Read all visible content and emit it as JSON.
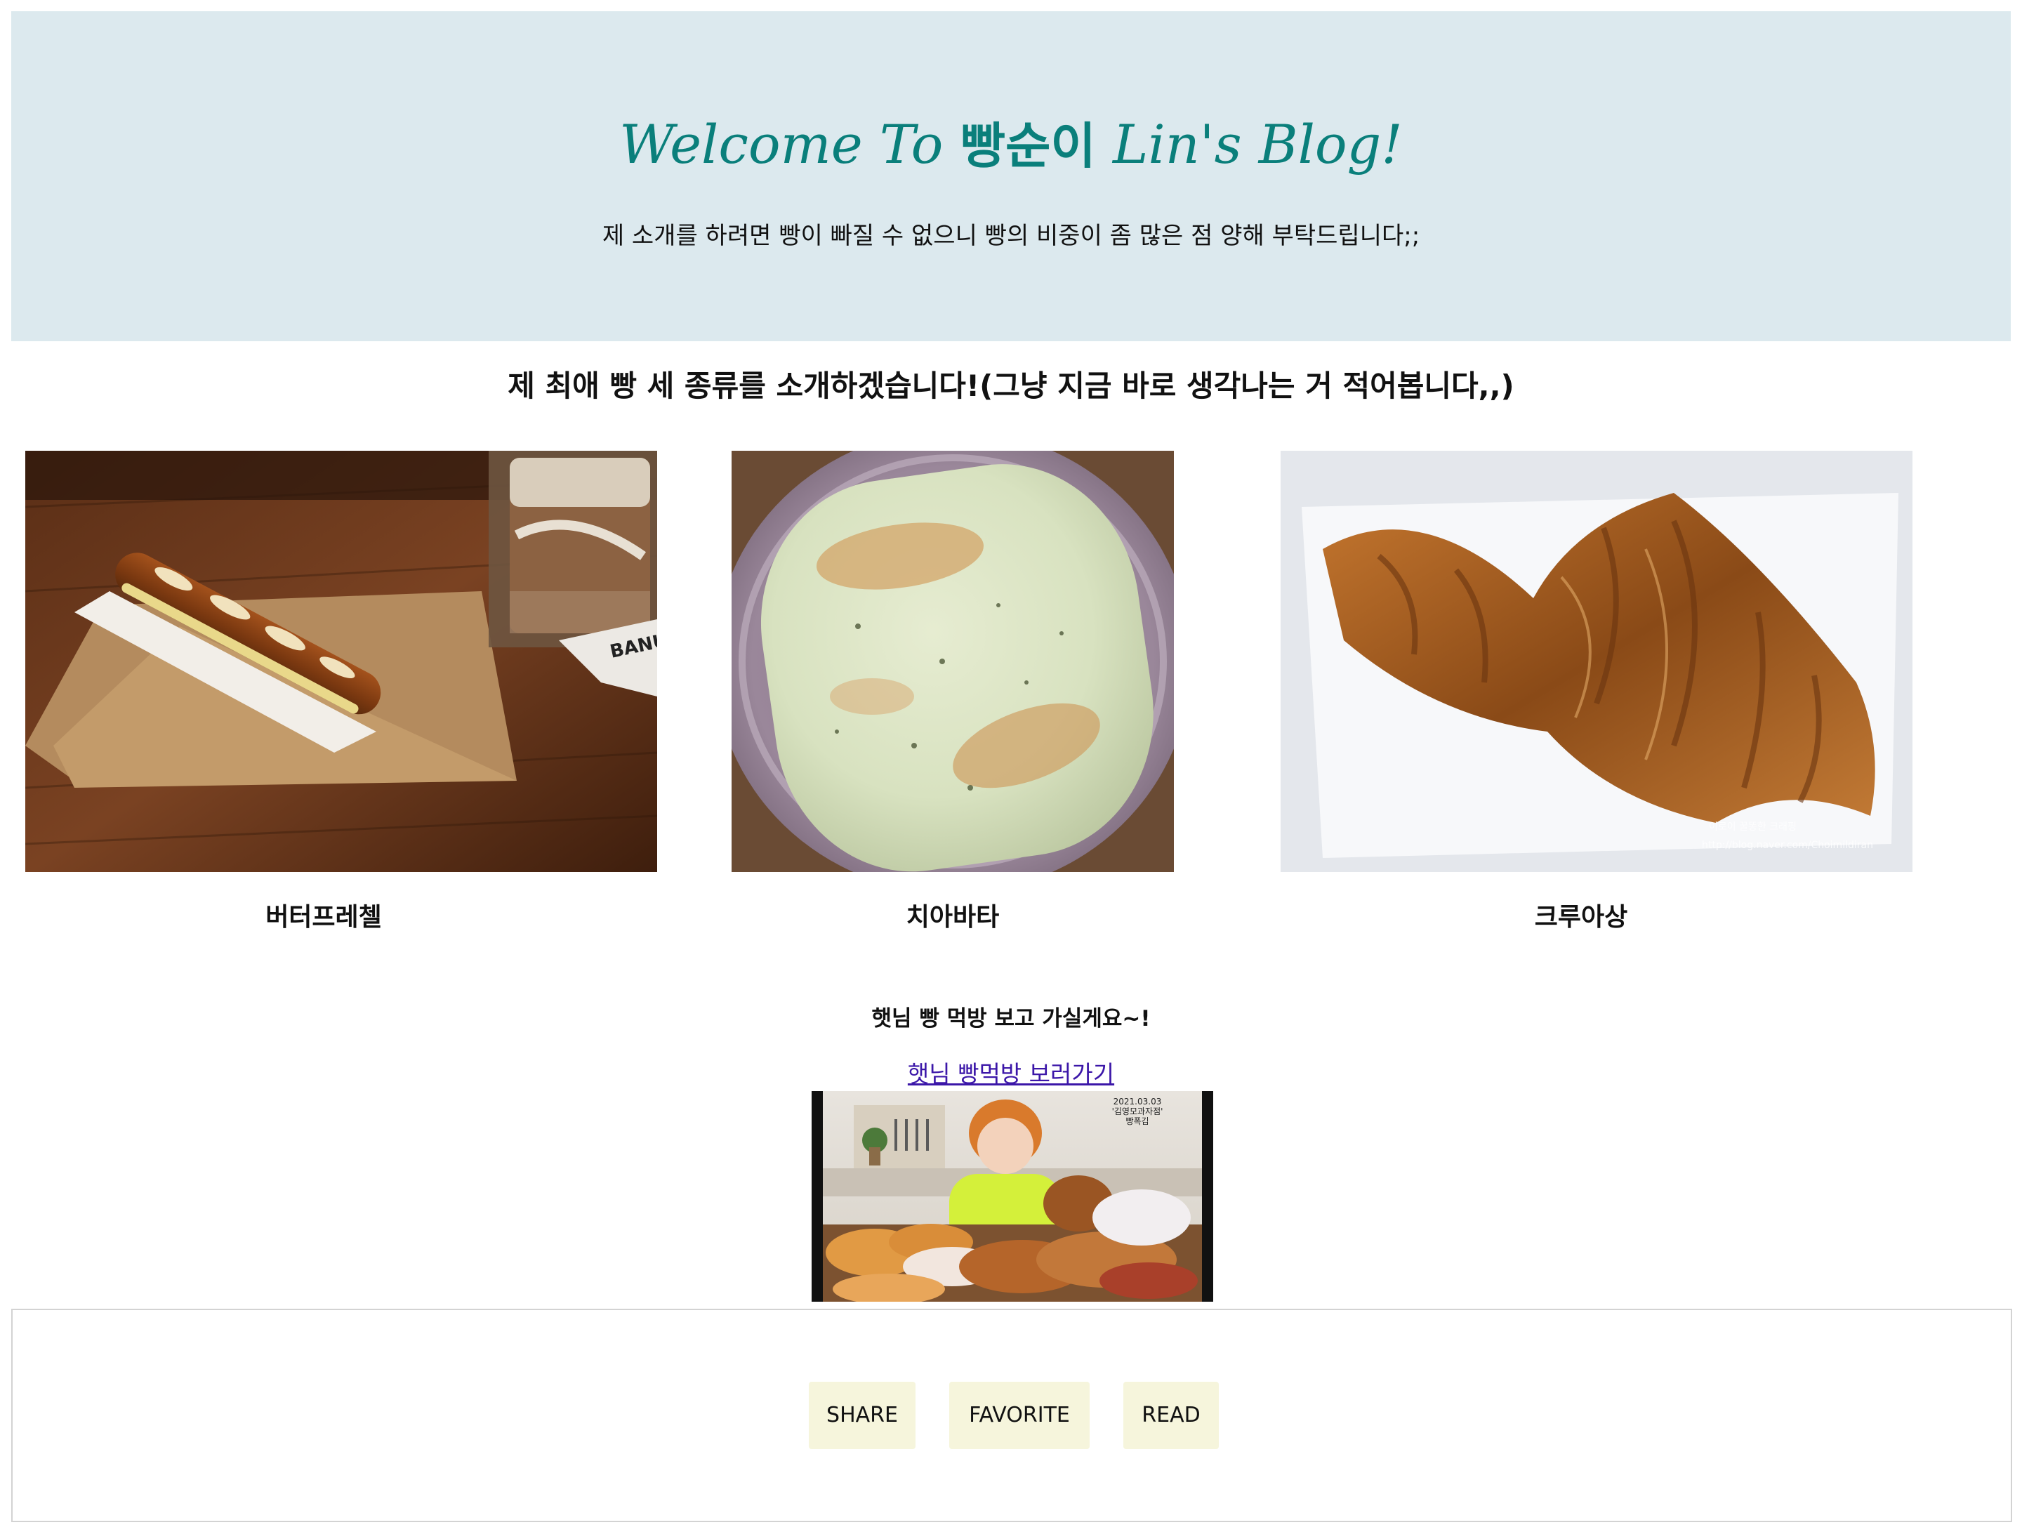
{
  "header": {
    "title_prefix": "Welcome To ",
    "title_name": "빵순이",
    "title_suffix": " Lin's Blog!",
    "subtitle": "제 소개를 하려면 빵이 빠질 수 없으니 빵의 비중이 좀 많은 점 양해 부탁드립니다;;",
    "background_color": "#dce9ee",
    "title_color": "#0a7f7b"
  },
  "favorites": {
    "heading": "제 최애 빵 세 종류를 소개하겠습니다!(그냥 지금 바로 생각나는 거 적어봅니다,,)",
    "items": [
      {
        "label": "버터프레첼",
        "image": "pretzel-photo"
      },
      {
        "label": "치아바타",
        "image": "ciabatta-photo"
      },
      {
        "label": "크루아상",
        "image": "croissant-photo"
      }
    ]
  },
  "mukbang": {
    "heading": "햇님 빵 먹방 보고 가실게요~!",
    "link_text": "햇님 빵먹방 보러가기",
    "link_color": "#3b16a8",
    "thumbnail": {
      "image": "mukbang-video-thumbnail",
      "date_text": "2021.03.03",
      "caption_line1": "'김영모과자점'",
      "caption_line2": "빵폭김"
    }
  },
  "footer": {
    "buttons": [
      {
        "label": "SHARE"
      },
      {
        "label": "FAVORITE"
      },
      {
        "label": "READ"
      }
    ],
    "button_color": "#f6f5dc",
    "border_color": "#d3d3d3"
  }
}
